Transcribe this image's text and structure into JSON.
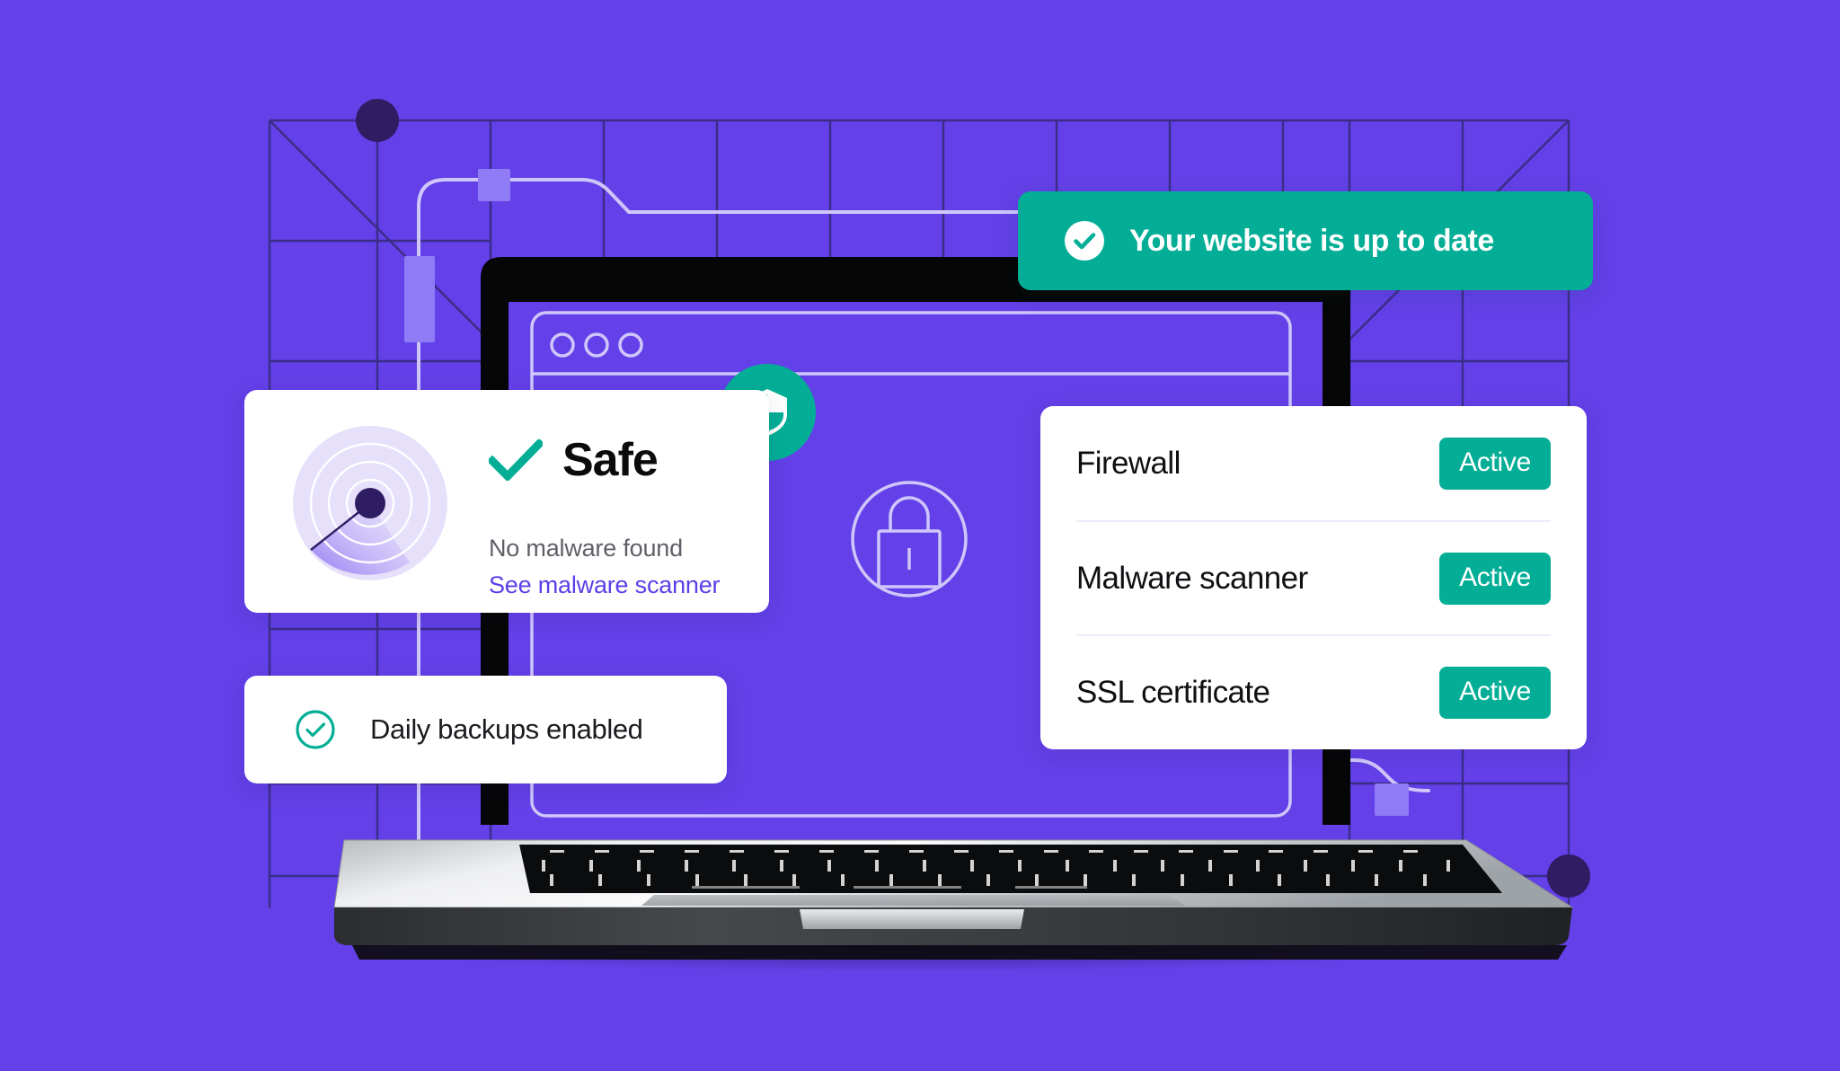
{
  "theme": {
    "background_purple": "#6340E8",
    "accent_green": "#04AE96",
    "link_indigo": "#5B3FE8",
    "node_navy": "#2E1D63",
    "trace_periwinkle": "#8E7BF5",
    "card_white": "#FFFFFF",
    "divider": "#EEEBFA"
  },
  "banner": {
    "icon": "check-circle-filled-icon",
    "text": "Your website is up to date"
  },
  "safe_card": {
    "icon": "checkmark-icon",
    "title": "Safe",
    "subtitle": "No malware found",
    "link_label": "See malware scanner",
    "graphic": "radar-scanner-icon"
  },
  "backups_card": {
    "icon": "check-circle-outline-icon",
    "label": "Daily backups enabled"
  },
  "status_card": {
    "rows": [
      {
        "name": "Firewall",
        "badge": "Active"
      },
      {
        "name": "Malware scanner",
        "badge": "Active"
      },
      {
        "name": "SSL certificate",
        "badge": "Active"
      }
    ]
  },
  "shield_badge": {
    "icon": "shield-icon"
  },
  "illustration": {
    "device": "macbook-laptop",
    "browser_window": {
      "traffic_lights": 3
    },
    "lock_node": {
      "icon": "padlock-icon"
    },
    "blueprint_nodes": 2,
    "trace_chips": 3
  }
}
